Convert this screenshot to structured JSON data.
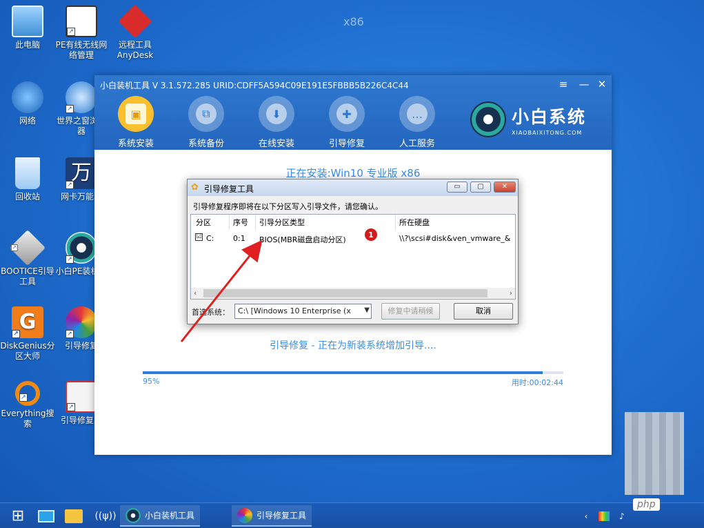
{
  "desktop": {
    "watermark": "x86",
    "icons": [
      {
        "label": "此电脑",
        "icon": "computer-icon"
      },
      {
        "label": "PE有线无线网络管理",
        "icon": "network-manager-icon"
      },
      {
        "label": "远程工具AnyDesk",
        "icon": "anydesk-icon"
      },
      {
        "label": "网络",
        "icon": "globe-network-icon"
      },
      {
        "label": "世界之窗浏览器",
        "icon": "browser-icon"
      },
      {
        "label": "回收站",
        "icon": "recycle-bin-icon"
      },
      {
        "label": "网卡万能驱",
        "icon": "driver-icon"
      },
      {
        "label": "BOOTICE引导工具",
        "icon": "bootice-icon"
      },
      {
        "label": "小白PE装机具",
        "icon": "xiaobai-pe-icon"
      },
      {
        "label": "DiskGenius分区大师",
        "icon": "diskgenius-icon"
      },
      {
        "label": "引导修复",
        "icon": "pinwheel-icon"
      },
      {
        "label": "Everything搜索",
        "icon": "search-icon"
      },
      {
        "label": "引导修复工",
        "icon": "repair-kit-icon"
      }
    ]
  },
  "main_window": {
    "title": "小白装机工具 V 3.1.572.285 URID:CDFF5A594C09E191E5FBBB5B226C4C44",
    "controls": {
      "menu": "≡",
      "minimize": "—",
      "close": "✕"
    },
    "nav": [
      {
        "label": "系统安装",
        "glyph": "▣",
        "active": true
      },
      {
        "label": "系统备份",
        "glyph": "⧉",
        "active": false
      },
      {
        "label": "在线安装",
        "glyph": "⬇",
        "active": false
      },
      {
        "label": "引导修复",
        "glyph": "✚",
        "active": false
      },
      {
        "label": "人工服务",
        "glyph": "…",
        "active": false
      }
    ],
    "brand": {
      "name": "小白系统",
      "sub": "XIAOBAIXITONG.COM"
    },
    "install_title": "正在安装:Win10 专业版 x86",
    "status_text": "引导修复 - 正在为新装系统增加引导....",
    "progress": {
      "percent_label": "95%",
      "value": 0.95,
      "elapsed": "用时:00:02:44"
    }
  },
  "dialog": {
    "title": "引导修复工具",
    "message": "引导修复程序即将在以下分区写入引导文件，请您确认。",
    "columns": [
      "分区",
      "序号",
      "引导分区类型",
      "所在硬盘"
    ],
    "rows": [
      {
        "checked": "☑",
        "partition": "C:",
        "index": "0:1",
        "boot_type": "BIOS(MBR磁盘启动分区)",
        "disk": "\\\\?\\scsi#disk&ven_vmware_&"
      }
    ],
    "preferred_label": "首选系统：",
    "preferred_value": "C:\\ [Windows 10 Enterprise (x",
    "repair_button": "修复中请稍候",
    "cancel_button": "取消",
    "annotation_number": "1"
  },
  "taskbar": {
    "apps": [
      {
        "label": "小白装机工具",
        "icon": "xiaobai-app-icon"
      },
      {
        "label": "引导修复工具",
        "icon": "pinwheel-app-icon"
      }
    ]
  },
  "overlay": {
    "watermark": "php"
  }
}
